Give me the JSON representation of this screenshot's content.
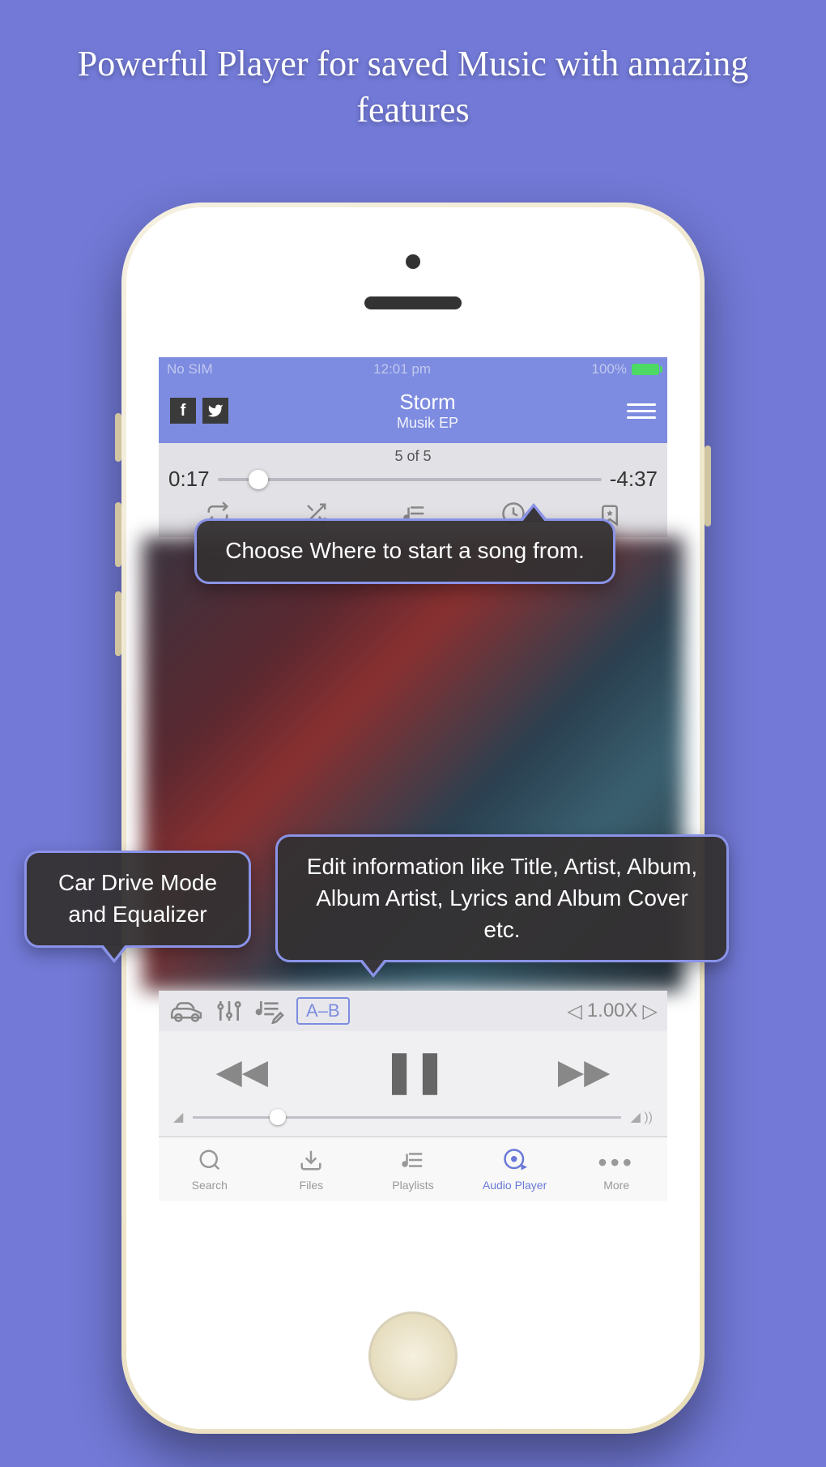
{
  "headline": "Powerful Player for saved Music with amazing features",
  "statusbar": {
    "carrier": "No SIM",
    "time": "12:01 pm",
    "battery": "100%"
  },
  "nowplaying": {
    "title": "Storm",
    "subtitle": "Musik EP"
  },
  "track": {
    "count": "5 of 5",
    "elapsed": "0:17",
    "remaining": "-4:37"
  },
  "toolbar2": {
    "ab": "A–B",
    "speed": "1.00X"
  },
  "tabs": [
    {
      "label": "Search"
    },
    {
      "label": "Files"
    },
    {
      "label": "Playlists"
    },
    {
      "label": "Audio Player"
    },
    {
      "label": "More"
    }
  ],
  "callouts": {
    "c1": "Choose Where to start a song from.",
    "c2": "Car Drive Mode and Equalizer",
    "c3": "Edit information like Title, Artist, Album, Album Artist, Lyrics and Album Cover etc."
  }
}
